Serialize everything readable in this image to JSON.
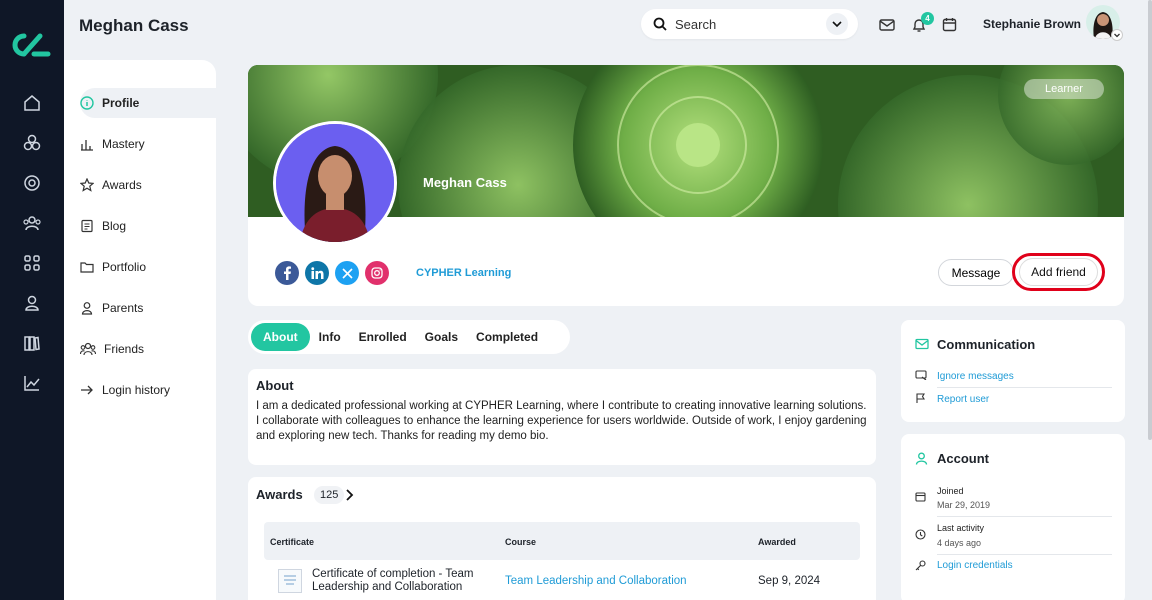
{
  "page": {
    "title": "Meghan Cass"
  },
  "search": {
    "placeholder": "Search"
  },
  "header": {
    "notifications_count": "4",
    "user_name": "Stephanie Brown"
  },
  "rail": {
    "icons": [
      "home-icon",
      "courses-icon",
      "target-icon",
      "groups-icon",
      "apps-icon",
      "user-icon",
      "library-icon",
      "analytics-icon"
    ]
  },
  "sidenav": {
    "items": [
      {
        "label": "Profile",
        "icon": "info-icon"
      },
      {
        "label": "Mastery",
        "icon": "bar-chart-icon"
      },
      {
        "label": "Awards",
        "icon": "star-icon"
      },
      {
        "label": "Blog",
        "icon": "blog-icon"
      },
      {
        "label": "Portfolio",
        "icon": "folder-icon"
      },
      {
        "label": "Parents",
        "icon": "parents-icon"
      },
      {
        "label": "Friends",
        "icon": "friends-icon"
      },
      {
        "label": "Login history",
        "icon": "login-icon"
      }
    ]
  },
  "profile": {
    "name": "Meghan Cass",
    "role": "Learner",
    "organization": "CYPHER Learning",
    "social": [
      "facebook-icon",
      "linkedin-icon",
      "x-icon",
      "instagram-icon"
    ],
    "message_label": "Message",
    "add_friend_label": "Add friend"
  },
  "tabs": [
    "About",
    "Info",
    "Enrolled",
    "Goals",
    "Completed"
  ],
  "about": {
    "title": "About",
    "text": "I am a dedicated professional working at CYPHER Learning, where I contribute to creating innovative learning solutions. I collaborate with colleagues to enhance the learning experience for users worldwide. Outside of work, I enjoy gardening and exploring new tech. Thanks for reading my demo bio."
  },
  "awards": {
    "title": "Awards",
    "count": "125",
    "columns": [
      "Certificate",
      "Course",
      "Awarded"
    ],
    "rows": [
      {
        "certificate": "Certificate of completion - Team Leadership and Collaboration",
        "course": "Team Leadership and Collaboration",
        "awarded": "Sep 9, 2024"
      }
    ]
  },
  "communication": {
    "title": "Communication",
    "links": [
      "Ignore messages",
      "Report user"
    ]
  },
  "account": {
    "title": "Account",
    "joined_label": "Joined",
    "joined_value": "Mar 29, 2019",
    "last_activity_label": "Last activity",
    "last_activity_value": "4 days ago",
    "credentials_label": "Login credentials"
  },
  "colors": {
    "accent": "#22c6a1",
    "rail": "#0f1727",
    "link": "#1f9bd6",
    "highlight": "#e0001a"
  }
}
